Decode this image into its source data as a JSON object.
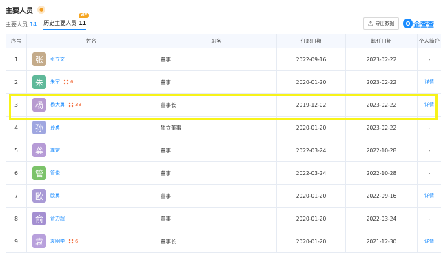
{
  "section": {
    "title": "主要人员"
  },
  "tabs": [
    {
      "label": "主要人员",
      "count": "14"
    },
    {
      "label": "历史主要人员",
      "count": "11",
      "vip": "VIP"
    }
  ],
  "toolbar": {
    "export_label": "导出数据",
    "brand_text": "企查查",
    "brand_logo": "Q"
  },
  "table": {
    "headers": [
      "序号",
      "姓名",
      "职务",
      "任职日期",
      "卸任日期",
      "个人简介"
    ],
    "rows": [
      {
        "index": "1",
        "avatar_char": "张",
        "avatar_color": "#c4ab8a",
        "name": "张立文",
        "relation": "",
        "position": "董事",
        "start": "2022-09-16",
        "end": "2023-02-22",
        "profile": "-"
      },
      {
        "index": "2",
        "avatar_char": "朱",
        "avatar_color": "#5fb99a",
        "name": "朱军",
        "relation": "6",
        "position": "董事",
        "start": "2020-01-20",
        "end": "2023-02-22",
        "profile": "详情"
      },
      {
        "index": "3",
        "avatar_char": "杨",
        "avatar_color": "#b79ad0",
        "name": "杨大勇",
        "relation": "33",
        "position": "董事长",
        "start": "2019-12-02",
        "end": "2023-02-22",
        "profile": "详情"
      },
      {
        "index": "4",
        "avatar_char": "孙",
        "avatar_color": "#9fa6e0",
        "name": "孙勇",
        "relation": "",
        "position": "独立董事",
        "start": "2020-01-20",
        "end": "2023-02-22",
        "profile": "-"
      },
      {
        "index": "5",
        "avatar_char": "龚",
        "avatar_color": "#b69bd6",
        "name": "龚定一",
        "relation": "",
        "position": "董事",
        "start": "2022-03-24",
        "end": "2022-10-28",
        "profile": "-"
      },
      {
        "index": "6",
        "avatar_char": "管",
        "avatar_color": "#7cc36a",
        "name": "管俊",
        "relation": "",
        "position": "董事",
        "start": "2022-03-24",
        "end": "2022-10-28",
        "profile": "-"
      },
      {
        "index": "7",
        "avatar_char": "欧",
        "avatar_color": "#a99ad6",
        "name": "欧勇",
        "relation": "",
        "position": "董事",
        "start": "2020-01-20",
        "end": "2022-09-16",
        "profile": "详情"
      },
      {
        "index": "8",
        "avatar_char": "俞",
        "avatar_color": "#a48fd1",
        "name": "俞力超",
        "relation": "",
        "position": "董事",
        "start": "2020-01-20",
        "end": "2022-03-24",
        "profile": "-"
      },
      {
        "index": "9",
        "avatar_char": "袁",
        "avatar_color": "#b8a0dc",
        "name": "袁明学",
        "relation": "6",
        "position": "董事长",
        "start": "2020-01-20",
        "end": "2021-12-30",
        "profile": "详情"
      }
    ]
  },
  "colors": {
    "accent": "#1a8cff",
    "highlight": "#f7f31a",
    "relation": "#f26b3a"
  }
}
